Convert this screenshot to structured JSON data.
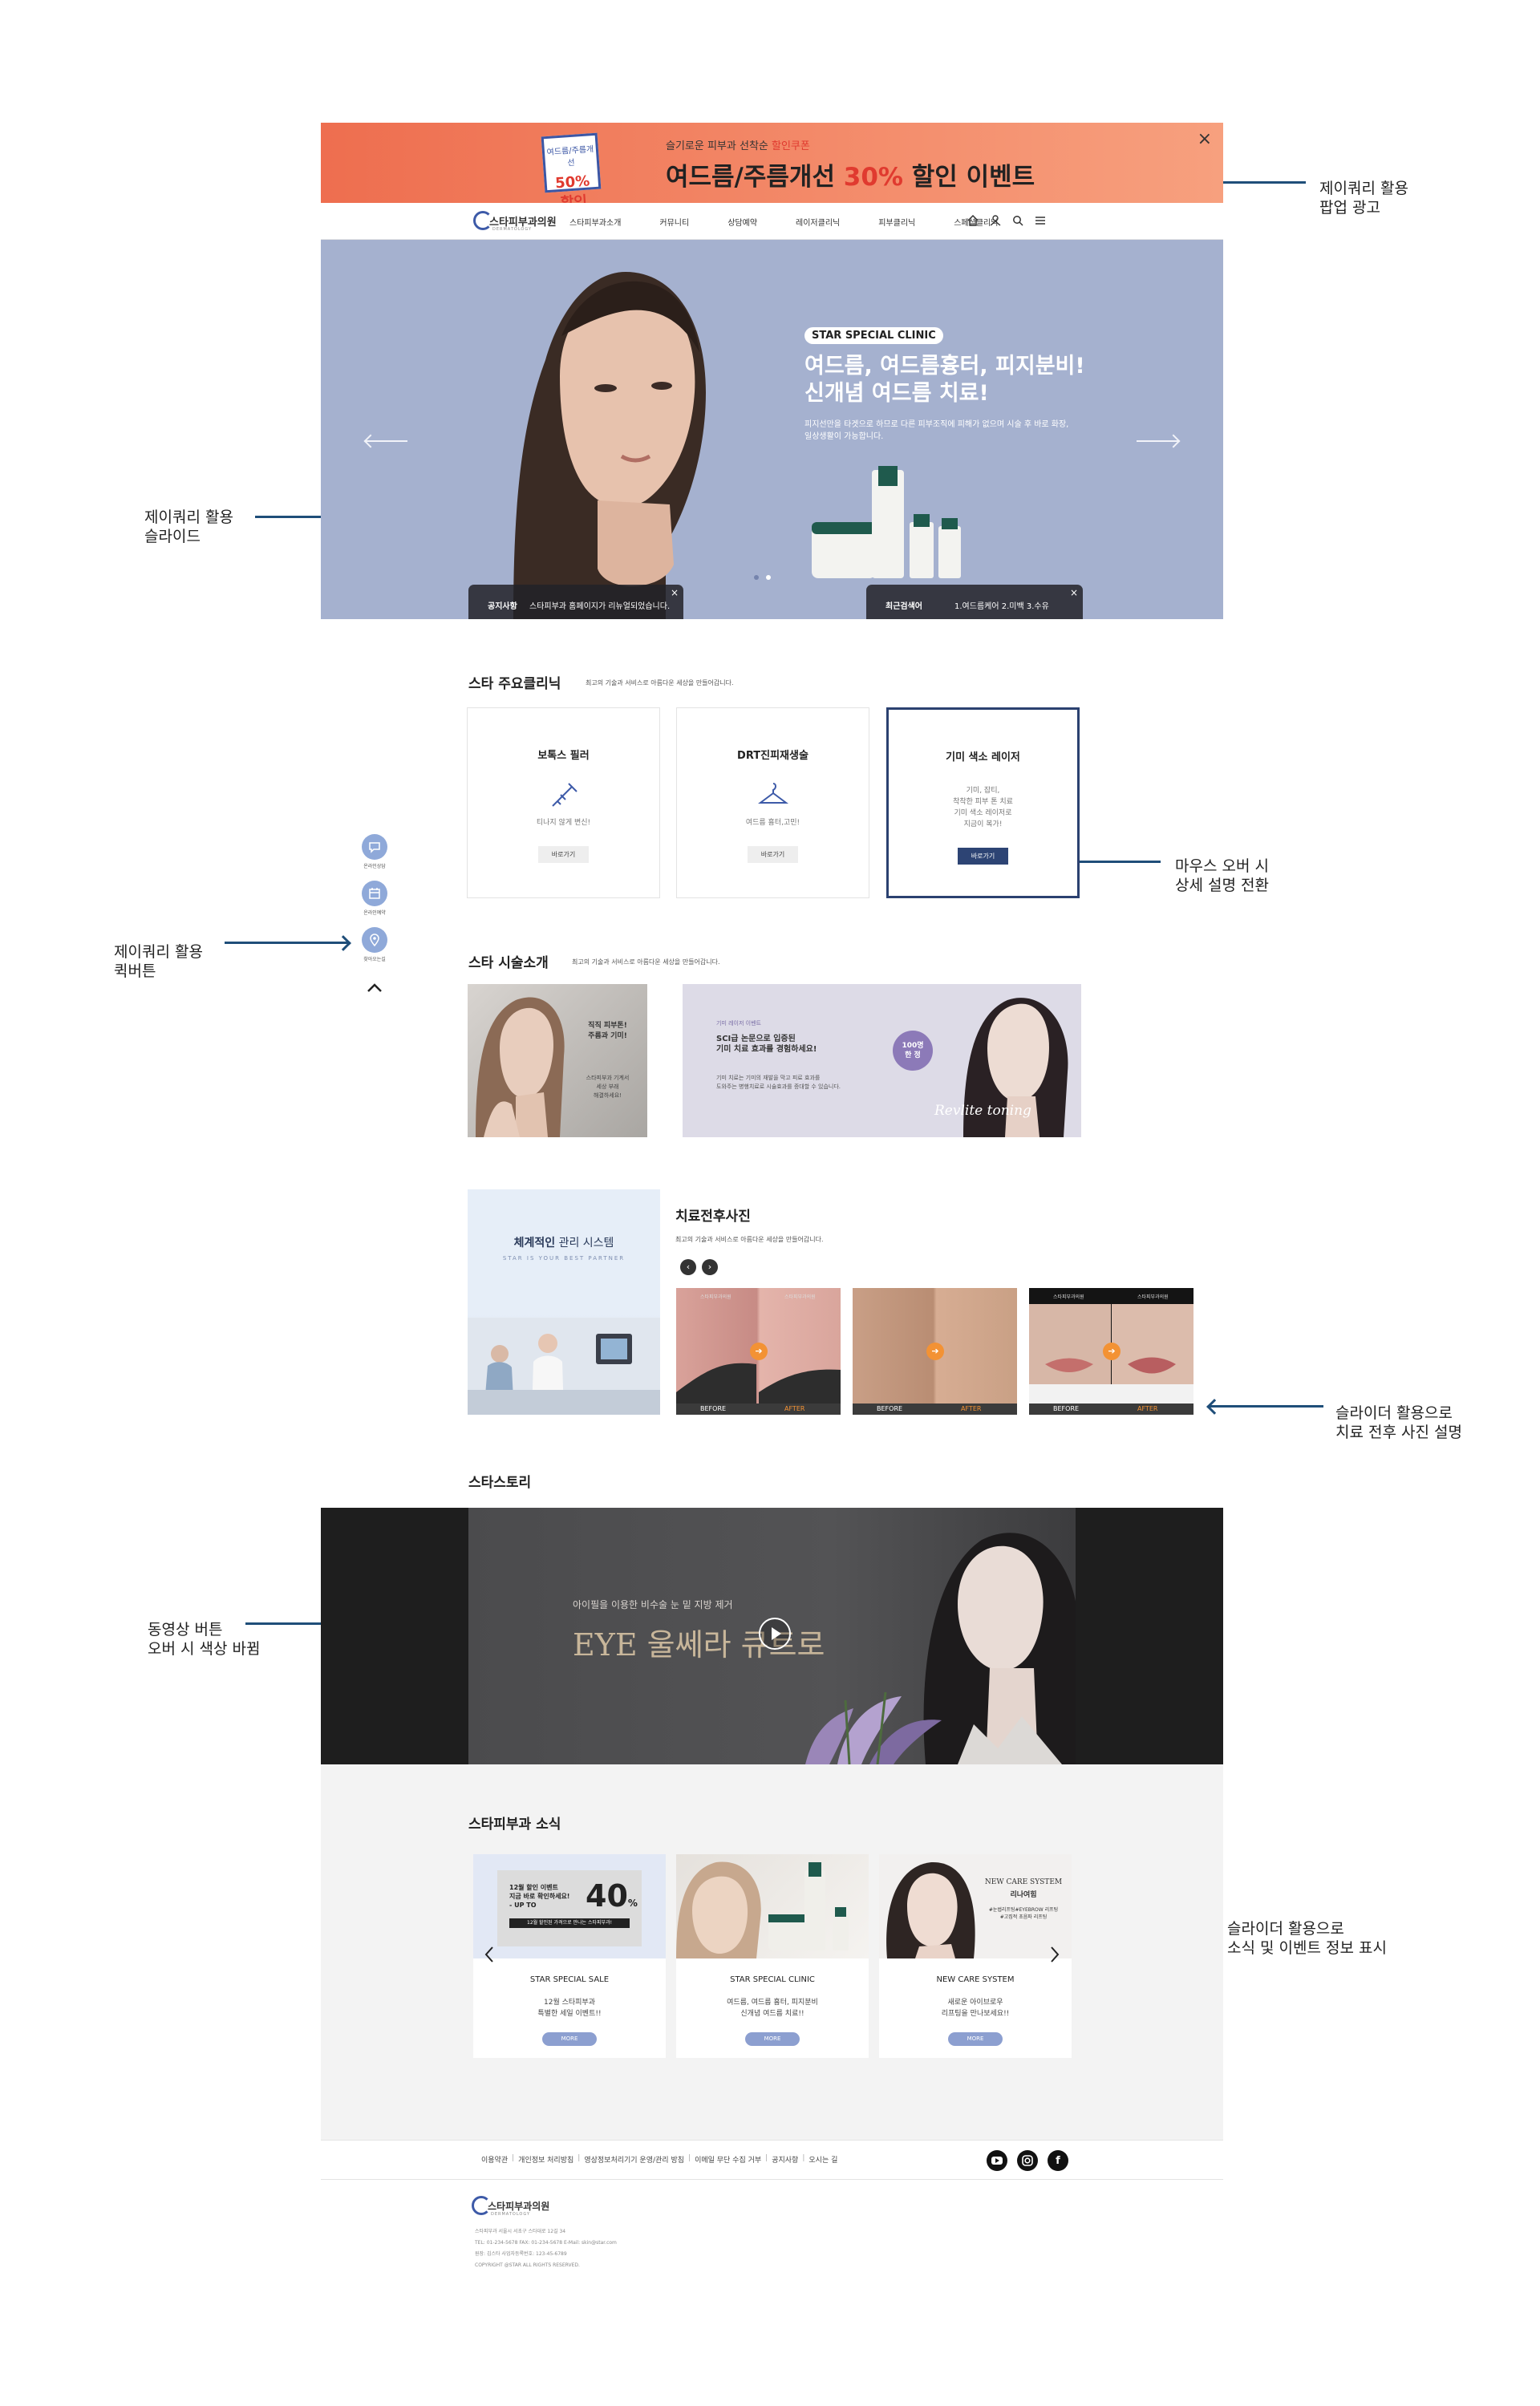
{
  "annotations": {
    "popup": [
      "제이쿼리 활용",
      "팝업 광고"
    ],
    "slide": [
      "제이쿼리 활용",
      "슬라이드"
    ],
    "quick": [
      "제이쿼리 활용",
      "퀵버튼"
    ],
    "hover": [
      "마우스 오버 시",
      "상세 설명 전환"
    ],
    "beforeafter": [
      "슬라이더 활용으로",
      "치료 전후 사진 설명"
    ],
    "video": [
      "동영상 버튼",
      "오버 시 색상 바뀜"
    ],
    "news": [
      "슬라이더 활용으로",
      "소식 및 이벤트 정보 표시"
    ]
  },
  "popup": {
    "badge_top": "여드름/주름개선",
    "badge_main": "50% 할인",
    "sub_prefix": "슬기로운 피부과 선착순",
    "sub_highlight": "할인쿠폰",
    "main_prefix": "여드름/주름개선",
    "main_highlight": "30%",
    "main_suffix": "할인 이벤트",
    "close": "×"
  },
  "nav": {
    "logo": "스타피부과의원",
    "logo_sub": "DERMATOLOGY",
    "menu": [
      "스타피부과소개",
      "커뮤니티",
      "상담예약",
      "레이저클리닉",
      "피부클리닉",
      "스페셜클리닉"
    ],
    "icons": [
      "home-icon",
      "user-icon",
      "search-icon",
      "menu-icon"
    ]
  },
  "hero": {
    "tag": "STAR SPECIAL CLINIC",
    "title_line1": "여드름, 여드름흉터, 피지분비!",
    "title_line2": "신개념 여드름 치료!",
    "desc": "피지선만을 타겟으로 하므로 다른 피부조직에 피해가 없으며 시술 후 바로 화장, 일상생활이 가능합니다.",
    "notice_label": "공지사항",
    "notice_text": "스타피부과 홈페이지가 리뉴얼되었습니다.",
    "search_label": "최근검색어",
    "search_text": "1.여드름케어 2.미백 3.수유",
    "close": "×",
    "slide_count": 2,
    "active_slide": 1
  },
  "clinic": {
    "title": "스타 주요클리닉",
    "subtitle": "최고의 기술과 서비스로 아름다운 세상을 만들어갑니다.",
    "cards": [
      {
        "title": "보톡스 필러",
        "desc": "티나지 않게 변신!",
        "button": "바로가기",
        "icon": "syringe-icon"
      },
      {
        "title": "DRT진피재생술",
        "desc": "여드름 흉터,고민!",
        "button": "바로가기",
        "icon": "hanger-icon"
      },
      {
        "title": "기미 색소 레이저",
        "desc": "기미, 잡티,\n착착한 피부 톤 치료\n기미 색소 레이저로\n지금이 복가!",
        "button": "바로가기",
        "icon": ""
      }
    ]
  },
  "quick": [
    {
      "label": "온라인상담",
      "icon": "chat-icon"
    },
    {
      "label": "온라인예약",
      "icon": "calendar-icon"
    },
    {
      "label": "찾아오는길",
      "icon": "map-pin-icon"
    }
  ],
  "quick_top": "⌃",
  "procedure": {
    "title": "스타 시술소개",
    "subtitle": "최고의 기술과 서비스로 아름다운 세상을 만들어갑니다.",
    "left_title": "직직 피부톤!",
    "left_title2": "주름과 기미!",
    "left_desc": "스타피부과 기계서\n세상 부래\n해결하세요!",
    "right_tag": "기미 레이저 이벤트",
    "right_title": "SCI급 논문으로 입증된\n기미 치료 효과를 경험하세요!",
    "right_desc": "기미 치료는 기미의 재발을 막고 피료 효과를\n도와주는 병행치료로 시술효과를 증대할 수 있습니다.",
    "right_badge": "100명\n한 정",
    "right_brand": "Revlite toning"
  },
  "system": {
    "title_bold": "체계적인",
    "title_rest": "관리 시스템",
    "tagline": "STAR IS YOUR BEST PARTNER"
  },
  "beforeafter": {
    "title": "치료전후사진",
    "subtitle": "최고의 기술과 서비스로 아름다운 세상을 만들어갑니다.",
    "before": "BEFORE",
    "after": "AFTER",
    "logo": "스타피부과의원"
  },
  "story": {
    "title": "스타스토리",
    "caption": "아이필을 이용한 비수술 눈 밑 지방 제거",
    "headline_en": "EYE",
    "headline_kr": "울쎄라 큐트로"
  },
  "news": {
    "title": "스타피부과 소식",
    "items": [
      {
        "title": "STAR SPECIAL SALE",
        "desc": "12월 스타피부과\n특별한 세일 이벤트!!",
        "button": "MORE"
      },
      {
        "title": "STAR SPECIAL CLINIC",
        "desc": "여드름, 여드름 흉터, 피지분비\n신개념 여드름 치료!!",
        "button": "MORE"
      },
      {
        "title": "NEW CARE SYSTEM",
        "desc": "새로운 아이브로우\n리프팅을 만나보세요!!",
        "button": "MORE"
      }
    ],
    "sale": {
      "line1": "12월 할인 이벤트",
      "line2": "지금 바로 확인하세요!",
      "line3": "- UP TO",
      "pct": "40",
      "strip": "12월 할인된 가격으로 만나는 스타피부과!"
    },
    "care": {
      "line1": "NEW CARE SYSTEM",
      "line2": "리나여힘",
      "line3": "#눈썹리프팅#EYEBROW 리프팅",
      "line4": "#고집적 초음파 리프팅"
    }
  },
  "footer": {
    "links": [
      "이용약관",
      "개인정보 처리방침",
      "영상정보처리기기 운영/관리 방침",
      "이메일 무단 수집 거부",
      "공지사항",
      "오시는 길"
    ],
    "sns": [
      "youtube-icon",
      "instagram-icon",
      "facebook-icon"
    ],
    "logo": "스타피부과의원",
    "logo_sub": "DERMATOLOGY",
    "info": [
      "스타피부과   서울시 서초구 스타대로 12길 34",
      "TEL: 01-234-5678   FAX: 01-234-5678   E-Mail: skin@star.com",
      "원장: 김스타   사업자등록번호: 123-45-6789",
      "COPYRIGHT @STAR ALL RIGHTS RESERVED."
    ]
  },
  "colors": {
    "accent": "#2b4170",
    "popup_start": "#ee6e4f",
    "popup_end": "#f7a07e",
    "hero_bg": "#a5b1cf",
    "quick": "#8fa9d9",
    "arrow": "#1f4e79"
  }
}
